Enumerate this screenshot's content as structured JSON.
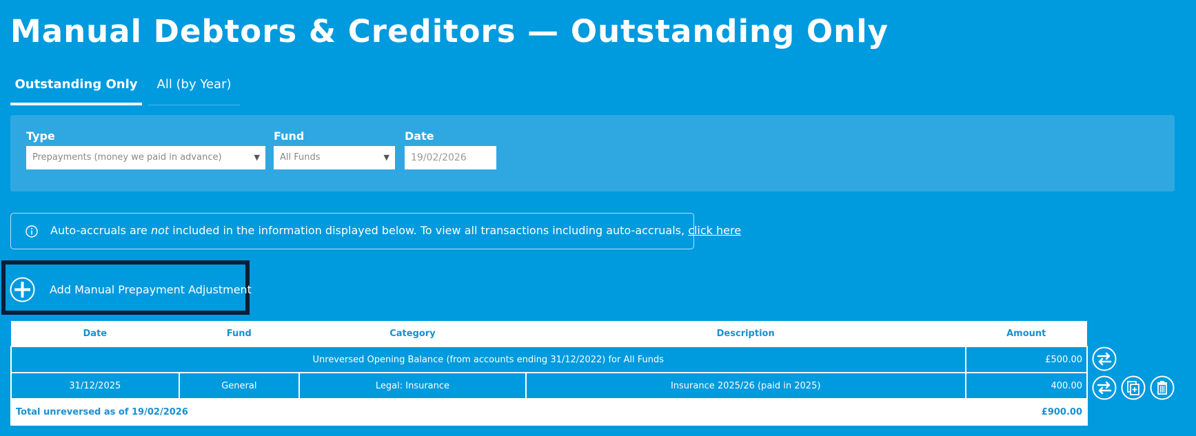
{
  "page": {
    "title": "Manual Debtors & Creditors — Outstanding Only"
  },
  "tabs": [
    {
      "label": "Outstanding Only",
      "active": true
    },
    {
      "label": "All (by Year)",
      "active": false
    }
  ],
  "filters": {
    "type_label": "Type",
    "type_value": "Prepayments (money we paid in advance)",
    "fund_label": "Fund",
    "fund_value": "All Funds",
    "date_label": "Date",
    "date_placeholder": "19/02/2026"
  },
  "notice": {
    "text_before": "Auto-accruals are ",
    "text_emphasis": "not",
    "text_after": " included in the information displayed below. To view all transactions including auto-accruals, ",
    "link_text": "click here",
    "icon": "info-icon"
  },
  "add_button": {
    "label": "Add Manual Prepayment Adjustment",
    "icon": "plus-circle-icon"
  },
  "table": {
    "headers": [
      "Date",
      "Fund",
      "Category",
      "Description",
      "Amount"
    ],
    "opening_row": {
      "text": "Unreversed Opening Balance (from accounts ending 31/12/2022) for All Funds",
      "amount": "£500.00"
    },
    "rows": [
      {
        "date": "31/12/2025",
        "fund": "General",
        "category": "Legal: Insurance",
        "description": "Insurance 2025/26 (paid in 2025)",
        "amount": "400.00"
      }
    ],
    "total": {
      "label": "Total unreversed as of 19/02/2026",
      "amount": "£900.00"
    }
  },
  "actions": {
    "reverse_icon": "reverse-arrows-icon",
    "copy_icon": "copy-icon",
    "delete_icon": "trash-icon"
  },
  "colors": {
    "background": "#009ade",
    "panel": "#2fa8e1",
    "header_text": "#1a8fd0",
    "highlight_border": "#0b1e36"
  }
}
